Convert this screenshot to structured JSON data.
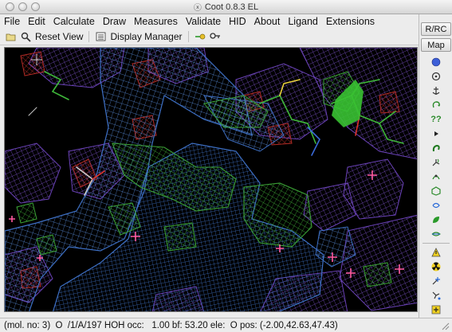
{
  "window": {
    "title": "Coot 0.8.3 EL",
    "x11_icon_glyph": "ⓧ"
  },
  "menubar": {
    "items": [
      "File",
      "Edit",
      "Calculate",
      "Draw",
      "Measures",
      "Validate",
      "HID",
      "About",
      "Ligand",
      "Extensions"
    ]
  },
  "toolbar": {
    "reset_view_label": "Reset View",
    "display_manager_label": "Display Manager"
  },
  "side_panel": {
    "rrc_label": "R/RC",
    "map_label": "Map"
  },
  "statusbar": {
    "text": "(mol. no: 3)  O  /1/A/197 HOH occ:   1.00 bf: 53.20 ele:  O pos: (-2.00,42.63,47.43)"
  },
  "colors": {
    "background": "#000000",
    "map_blue": "#4f86d6",
    "map_green": "#3fbf3a",
    "map_purple": "#7b4fc9",
    "map_red": "#c8322a",
    "water_cross": "#ff5aa0"
  },
  "icons": {
    "toolbar": [
      "folder-icon",
      "zoom-icon",
      "reset-view-icon",
      "display-manager-icon",
      "green-arrow-icon",
      "key-icon"
    ],
    "side": [
      "sphere-icon",
      "refine-icon",
      "anchor-icon",
      "rotate-icon",
      "question-icon",
      "triangle-right-icon",
      "jiggle-icon",
      "torsion-icon",
      "fragment-icon",
      "ring-icon",
      "swirl-icon",
      "green-leaf-icon",
      "map-fit-icon",
      "warning-icon",
      "radiation-icon",
      "add-atom-icon",
      "chain-icon",
      "plus-box-icon",
      "triangle-down-icon"
    ]
  }
}
